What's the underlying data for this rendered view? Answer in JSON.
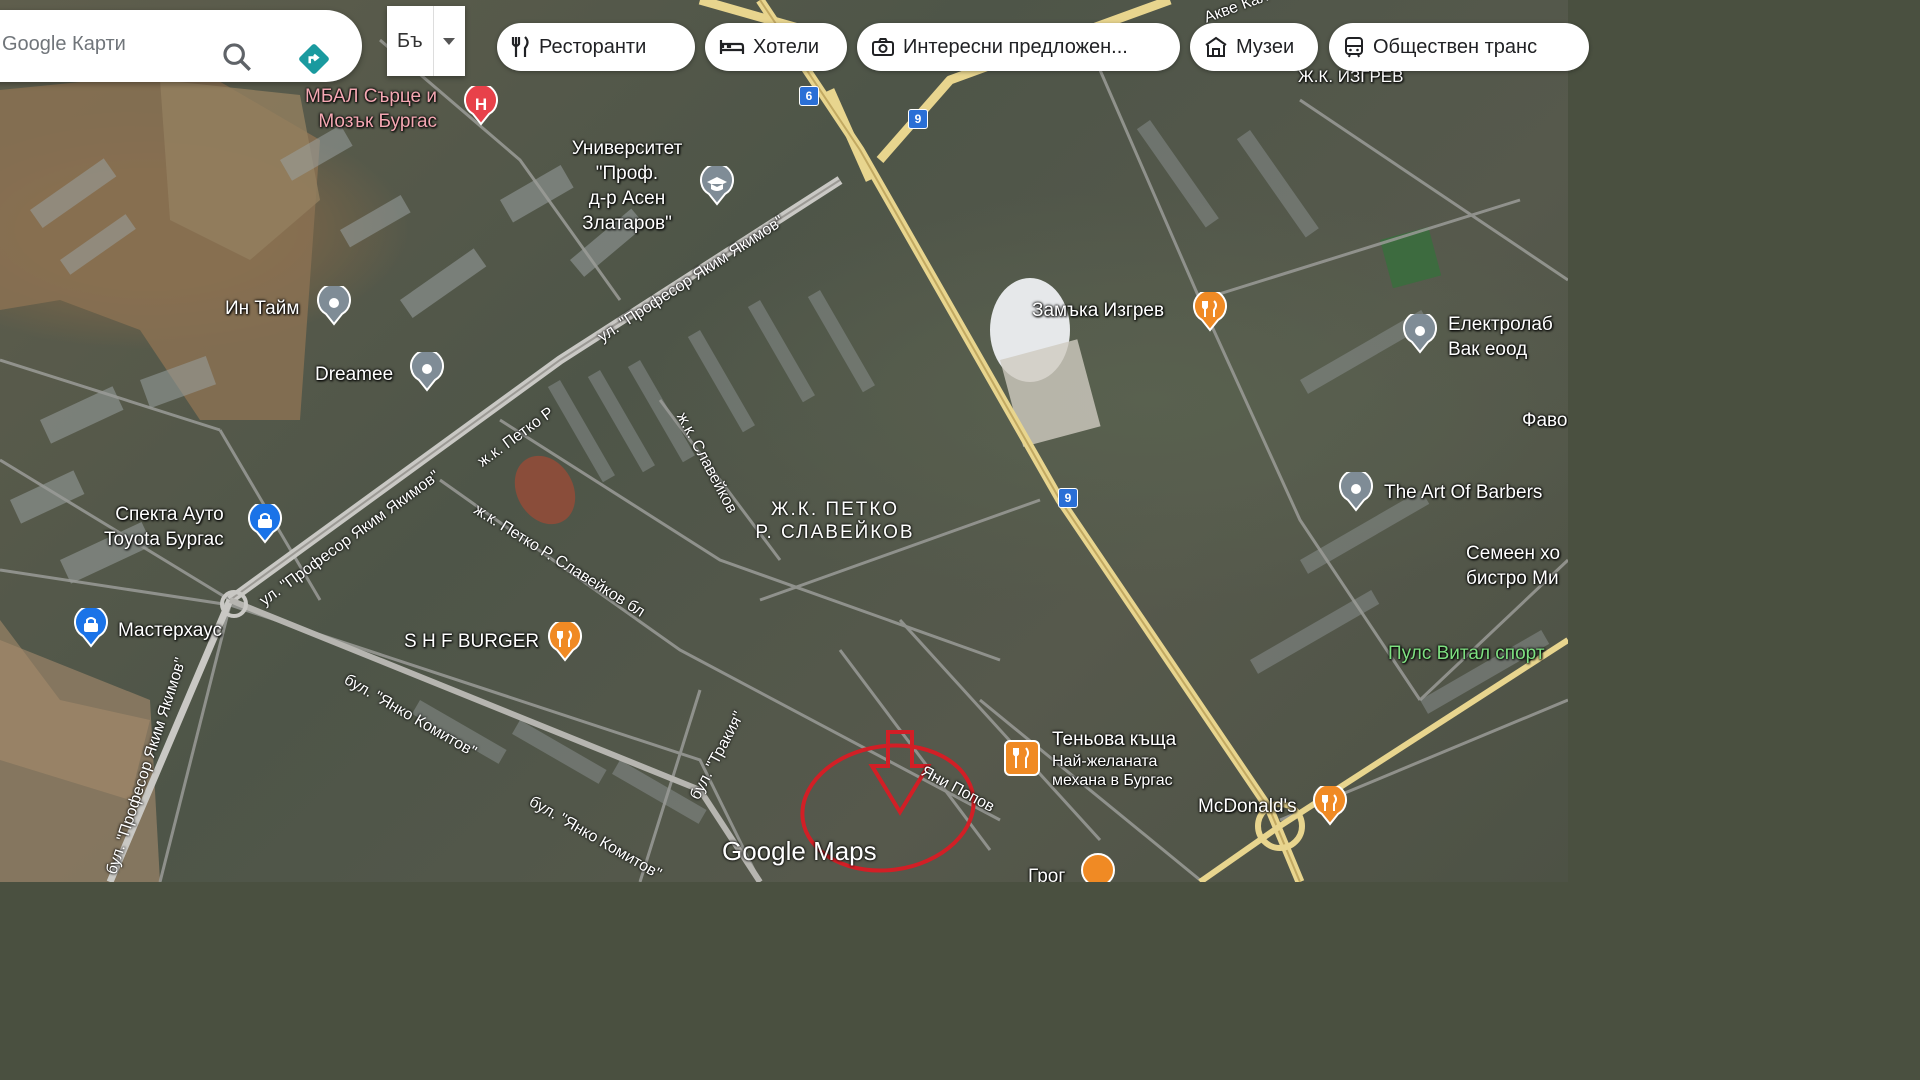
{
  "search": {
    "placeholder": "Google Карти"
  },
  "language_button": {
    "label": "Бъ"
  },
  "chips": [
    {
      "label": "Ресторанти",
      "icon": "fork-knife-icon"
    },
    {
      "label": "Хотели",
      "icon": "bed-icon"
    },
    {
      "label": "Интересни предложен...",
      "icon": "camera-icon"
    },
    {
      "label": "Музеи",
      "icon": "museum-icon"
    },
    {
      "label": "Обществен транс",
      "icon": "transit-icon"
    }
  ],
  "places": {
    "hospital": "МБАЛ Сърце и\nМозък Бургас",
    "university": "Университет\n\"Проф.\nд-р Асен\nЗлатаров\"",
    "in_time": "Ин Тайм",
    "dreamee": "Dreamee",
    "zamaka": "Замъка Изгрев",
    "elektrolab": "Електролаб\nВак еоод",
    "favo": "Фаво",
    "art_of_barbers": "The Art Of Barbers",
    "semeen": "Семеен хо\nбистро Ми",
    "spekta": "Спекта Ауто\nToyota Бургас",
    "masterhaus": "Мастерхаус",
    "shf_burger": "S H F BURGER",
    "pulse": "Пулс Витал спорт",
    "tenyova": "Теньова къща",
    "tenyova_sub": "Най-желаната\nмехана в Бургас",
    "mcdonalds": "McDonald's",
    "grog": "Грог",
    "izgrev": "Ж.К. ИЗГРЕВ"
  },
  "district": "Ж.К. ПЕТКО\nР. СЛАВЕЙКОВ",
  "streets": {
    "yakim1": "ул. \"Професор Яким Якимов\"",
    "yakim2": "ул. \"Професор Яким Якимов\"",
    "yakim3": "бул. \"Професор Яким Якимов\"",
    "petko_r": "ж.к. Петко Р",
    "slaveikov": "ж.к. Славейков",
    "slaveikov_bl": "ж.к. Петко Р. Славейков бл",
    "komitov1": "бул. \"Янко Комитов\"",
    "komitov2": "бул. \"Янко Комитов\"",
    "trakia": "бул. \"Тракия\"",
    "yani": "Яни Попов",
    "top": "Акве Кал"
  },
  "road_shields": [
    "6",
    "9",
    "9"
  ],
  "watermark": "Google Maps",
  "colors": {
    "highlight": "#d21f26",
    "food_pin": "#f08a24",
    "hospital_pin": "#e8414a",
    "blue_pin": "#1a73e8"
  }
}
